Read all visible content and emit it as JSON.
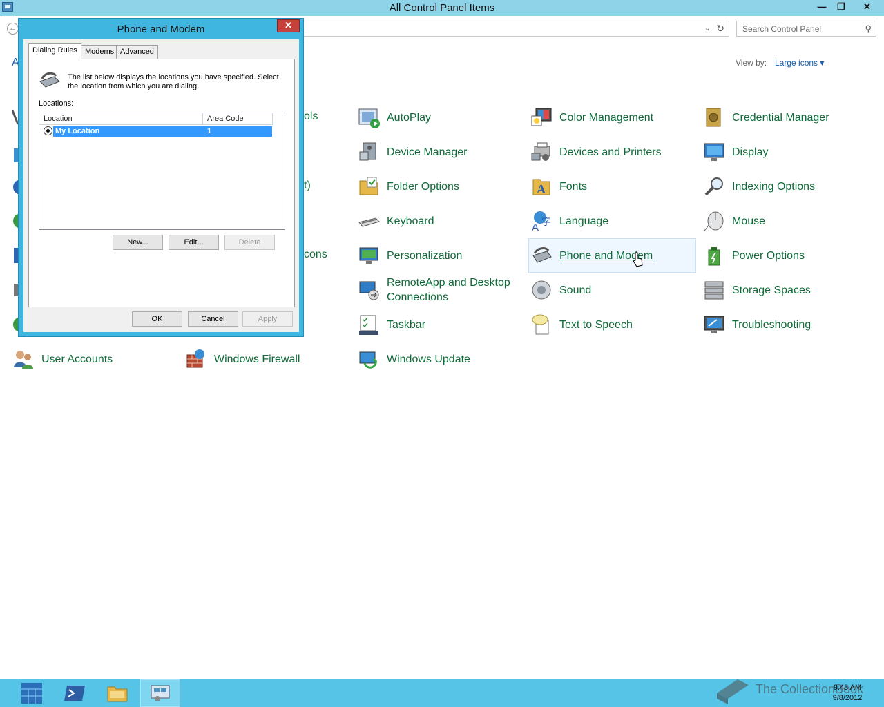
{
  "window": {
    "title": "All Control Panel Items",
    "buttons": {
      "minimize": "—",
      "maximize": "❐",
      "close": "✕"
    }
  },
  "address": {
    "dropdown_icon": "chevron-down-icon",
    "refresh_icon": "refresh-icon"
  },
  "search": {
    "placeholder": "Search Control Panel",
    "icon": "search-icon"
  },
  "header": {
    "partial_text": "A"
  },
  "view_by": {
    "label": "View by:",
    "value": "Large icons ▾"
  },
  "partial_labels": [
    "ols",
    "t)",
    "cons"
  ],
  "items": [
    {
      "label": "AutoPlay",
      "icon": "autoplay-icon"
    },
    {
      "label": "Color Management",
      "icon": "color-management-icon"
    },
    {
      "label": "Credential Manager",
      "icon": "credential-manager-icon"
    },
    {
      "label": "Device Manager",
      "icon": "device-manager-icon"
    },
    {
      "label": "Devices and Printers",
      "icon": "devices-printers-icon"
    },
    {
      "label": "Display",
      "icon": "display-icon"
    },
    {
      "label": "Folder Options",
      "icon": "folder-options-icon"
    },
    {
      "label": "Fonts",
      "icon": "fonts-icon"
    },
    {
      "label": "Indexing Options",
      "icon": "indexing-options-icon"
    },
    {
      "label": "Keyboard",
      "icon": "keyboard-icon"
    },
    {
      "label": "Language",
      "icon": "language-icon"
    },
    {
      "label": "Mouse",
      "icon": "mouse-icon"
    },
    {
      "label": "Personalization",
      "icon": "personalization-icon"
    },
    {
      "label": "Phone and Modem",
      "icon": "phone-modem-icon"
    },
    {
      "label": "Power Options",
      "icon": "power-options-icon"
    },
    {
      "label": "RemoteApp and Desktop",
      "label2": "Connections",
      "icon": "remoteapp-icon"
    },
    {
      "label": "Sound",
      "icon": "sound-icon"
    },
    {
      "label": "Storage Spaces",
      "icon": "storage-spaces-icon"
    },
    {
      "label": "Taskbar",
      "icon": "taskbar-icon"
    },
    {
      "label": "Text to Speech",
      "icon": "text-to-speech-icon"
    },
    {
      "label": "Troubleshooting",
      "icon": "troubleshooting-icon"
    },
    {
      "label": "User Accounts",
      "icon": "user-accounts-icon"
    },
    {
      "label": "Windows Firewall",
      "icon": "windows-firewall-icon"
    },
    {
      "label": "Windows Update",
      "icon": "windows-update-icon"
    }
  ],
  "dialog": {
    "title": "Phone and Modem",
    "close": "✕",
    "tabs": [
      "Dialing Rules",
      "Modems",
      "Advanced"
    ],
    "description": "The list below displays the locations you have specified. Select the location from which you are dialing.",
    "locations_label": "Locations:",
    "columns": [
      "Location",
      "Area Code"
    ],
    "rows": [
      {
        "location": "My Location",
        "area_code": "1"
      }
    ],
    "buttons": {
      "new": "New...",
      "edit": "Edit...",
      "delete": "Delete",
      "ok": "OK",
      "cancel": "Cancel",
      "apply": "Apply"
    }
  },
  "taskbar": {
    "buttons": [
      "start-icon",
      "powershell-icon",
      "file-explorer-icon",
      "control-panel-icon"
    ],
    "watermark": "The CollectionBook",
    "time": "9:43 AM",
    "date": "9/8/2012"
  }
}
